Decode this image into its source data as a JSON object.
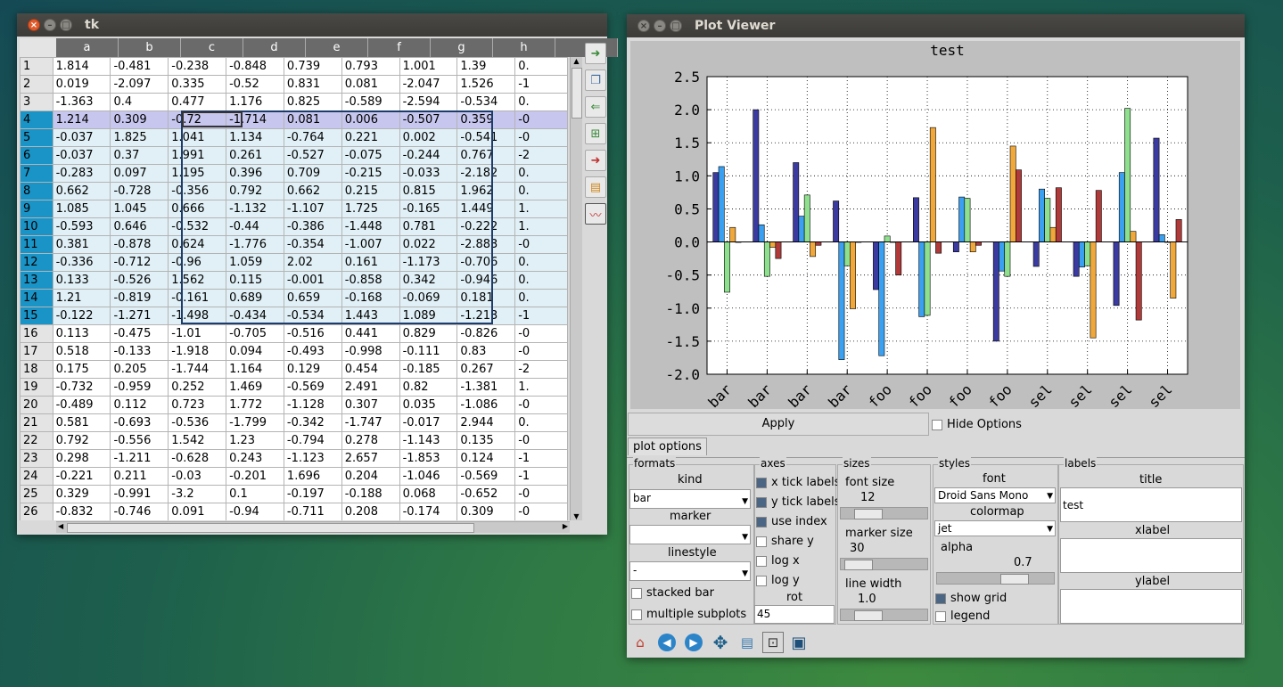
{
  "table_window": {
    "title": "tk",
    "columns": [
      "a",
      "b",
      "c",
      "d",
      "e",
      "f",
      "g",
      "h",
      ""
    ],
    "rows": [
      {
        "n": "1",
        "cells": [
          "1.814",
          "-0.481",
          "-0.238",
          "-0.848",
          "0.739",
          "0.793",
          "1.001",
          "1.39",
          "0."
        ]
      },
      {
        "n": "2",
        "cells": [
          "0.019",
          "-2.097",
          "0.335",
          "-0.52",
          "0.831",
          "0.081",
          "-2.047",
          "1.526",
          "-1"
        ]
      },
      {
        "n": "3",
        "cells": [
          "-1.363",
          "0.4",
          "0.477",
          "1.176",
          "0.825",
          "-0.589",
          "-2.594",
          "-0.534",
          "0."
        ]
      },
      {
        "n": "4",
        "cells": [
          "1.214",
          "0.309",
          "-0.72",
          "-1.714",
          "0.081",
          "0.006",
          "-0.507",
          "0.359",
          "-0"
        ]
      },
      {
        "n": "5",
        "cells": [
          "-0.037",
          "1.825",
          "1.041",
          "1.134",
          "-0.764",
          "0.221",
          "0.002",
          "-0.541",
          "-0"
        ]
      },
      {
        "n": "6",
        "cells": [
          "-0.037",
          "0.37",
          "1.991",
          "0.261",
          "-0.527",
          "-0.075",
          "-0.244",
          "0.767",
          "-2"
        ]
      },
      {
        "n": "7",
        "cells": [
          "-0.283",
          "0.097",
          "1.195",
          "0.396",
          "0.709",
          "-0.215",
          "-0.033",
          "-2.182",
          "0."
        ]
      },
      {
        "n": "8",
        "cells": [
          "0.662",
          "-0.728",
          "-0.356",
          "0.792",
          "0.662",
          "0.215",
          "0.815",
          "1.962",
          "0."
        ]
      },
      {
        "n": "9",
        "cells": [
          "1.085",
          "1.045",
          "0.666",
          "-1.132",
          "-1.107",
          "1.725",
          "-0.165",
          "1.449",
          "1."
        ]
      },
      {
        "n": "10",
        "cells": [
          "-0.593",
          "0.646",
          "-0.532",
          "-0.44",
          "-0.386",
          "-1.448",
          "0.781",
          "-0.222",
          "1."
        ]
      },
      {
        "n": "11",
        "cells": [
          "0.381",
          "-0.878",
          "0.624",
          "-1.776",
          "-0.354",
          "-1.007",
          "0.022",
          "-2.883",
          "-0"
        ]
      },
      {
        "n": "12",
        "cells": [
          "-0.336",
          "-0.712",
          "-0.96",
          "1.059",
          "2.02",
          "0.161",
          "-1.173",
          "-0.706",
          "0."
        ]
      },
      {
        "n": "13",
        "cells": [
          "0.133",
          "-0.526",
          "1.562",
          "0.115",
          "-0.001",
          "-0.858",
          "0.342",
          "-0.946",
          "0."
        ]
      },
      {
        "n": "14",
        "cells": [
          "1.21",
          "-0.819",
          "-0.161",
          "0.689",
          "0.659",
          "-0.168",
          "-0.069",
          "0.181",
          "0."
        ]
      },
      {
        "n": "15",
        "cells": [
          "-0.122",
          "-1.271",
          "-1.498",
          "-0.434",
          "-0.534",
          "1.443",
          "1.089",
          "-1.213",
          "-1"
        ]
      },
      {
        "n": "16",
        "cells": [
          "0.113",
          "-0.475",
          "-1.01",
          "-0.705",
          "-0.516",
          "0.441",
          "0.829",
          "-0.826",
          "-0"
        ]
      },
      {
        "n": "17",
        "cells": [
          "0.518",
          "-0.133",
          "-1.918",
          "0.094",
          "-0.493",
          "-0.998",
          "-0.111",
          "0.83",
          "-0"
        ]
      },
      {
        "n": "18",
        "cells": [
          "0.175",
          "0.205",
          "-1.744",
          "1.164",
          "0.129",
          "0.454",
          "-0.185",
          "0.267",
          "-2"
        ]
      },
      {
        "n": "19",
        "cells": [
          "-0.732",
          "-0.959",
          "0.252",
          "1.469",
          "-0.569",
          "2.491",
          "0.82",
          "-1.381",
          "1."
        ]
      },
      {
        "n": "20",
        "cells": [
          "-0.489",
          "0.112",
          "0.723",
          "1.772",
          "-1.128",
          "0.307",
          "0.035",
          "-1.086",
          "-0"
        ]
      },
      {
        "n": "21",
        "cells": [
          "0.581",
          "-0.693",
          "-0.536",
          "-1.799",
          "-0.342",
          "-1.747",
          "-0.017",
          "2.944",
          "0."
        ]
      },
      {
        "n": "22",
        "cells": [
          "0.792",
          "-0.556",
          "1.542",
          "1.23",
          "-0.794",
          "0.278",
          "-1.143",
          "0.135",
          "-0"
        ]
      },
      {
        "n": "23",
        "cells": [
          "0.298",
          "-1.211",
          "-0.628",
          "0.243",
          "-1.123",
          "2.657",
          "-1.853",
          "0.124",
          "-1"
        ]
      },
      {
        "n": "24",
        "cells": [
          "-0.221",
          "0.211",
          "-0.03",
          "-0.201",
          "1.696",
          "0.204",
          "-1.046",
          "-0.569",
          "-1"
        ]
      },
      {
        "n": "25",
        "cells": [
          "0.329",
          "-0.991",
          "-3.2",
          "0.1",
          "-0.197",
          "-0.188",
          "0.068",
          "-0.652",
          "-0"
        ]
      },
      {
        "n": "26",
        "cells": [
          "-0.832",
          "-0.746",
          "0.091",
          "-0.94",
          "-0.711",
          "0.208",
          "-0.174",
          "0.309",
          "-0"
        ]
      }
    ],
    "highlight_row": "4",
    "selected_rows": [
      "4",
      "5",
      "6",
      "7",
      "8",
      "9",
      "10",
      "11",
      "12",
      "13",
      "14",
      "15"
    ],
    "toolbar_icons": [
      "import-icon",
      "copy-icon",
      "paste-icon",
      "add-column-icon",
      "delete-icon",
      "clear-icon",
      "plot-icon"
    ]
  },
  "plot_window": {
    "title": "Plot Viewer",
    "apply_label": "Apply",
    "hide_options_label": "Hide Options",
    "tab_label": "plot options",
    "formats": {
      "group": "formats",
      "kind_label": "kind",
      "kind_value": "bar",
      "marker_label": "marker",
      "marker_value": "",
      "linestyle_label": "linestyle",
      "linestyle_value": "-",
      "stacked_label": "stacked bar",
      "multiple_label": "multiple subplots"
    },
    "axes": {
      "group": "axes",
      "x_tick": "x tick labels",
      "y_tick": "y tick labels",
      "use_index": "use index",
      "share_y": "share y",
      "log_x": "log x",
      "log_y": "log y",
      "rot_label": "rot",
      "rot_value": "45"
    },
    "sizes": {
      "group": "sizes",
      "font_size_label": "font size",
      "font_size_value": "12",
      "marker_size_label": "marker size",
      "marker_size_value": "30",
      "line_width_label": "line width",
      "line_width_value": "1.0"
    },
    "styles": {
      "group": "styles",
      "font_label": "font",
      "font_value": "Droid Sans Mono",
      "colormap_label": "colormap",
      "colormap_value": "jet",
      "alpha_label": "alpha",
      "alpha_value": "0.7",
      "show_grid": "show grid",
      "legend": "legend"
    },
    "labels": {
      "group": "labels",
      "title_label": "title",
      "title_value": "test",
      "xlabel_label": "xlabel",
      "xlabel_value": "",
      "ylabel_label": "ylabel",
      "ylabel_value": ""
    },
    "nav_icons": [
      "home-icon",
      "back-icon",
      "forward-icon",
      "pan-icon",
      "configure-icon",
      "zoom-icon",
      "save-icon"
    ]
  },
  "chart_data": {
    "type": "bar",
    "title": "test",
    "categories": [
      "bar",
      "bar",
      "bar",
      "bar",
      "foo",
      "foo",
      "foo",
      "foo",
      "sel",
      "sel",
      "sel",
      "sel"
    ],
    "ylim": [
      -2.0,
      2.5
    ],
    "yticks": [
      "2.5",
      "2.0",
      "1.5",
      "1.0",
      "0.5",
      "0.0",
      "-0.5",
      "-1.0",
      "-1.5",
      "-2.0"
    ],
    "grid": true,
    "colors": [
      "#3a3aa0",
      "#3ba0f0",
      "#8ee08e",
      "#f0a83a",
      "#b03a3a"
    ],
    "series": [
      {
        "values": [
          1.05,
          2.0,
          1.2,
          0.62,
          -0.72,
          0.67,
          -0.15,
          -1.5,
          -0.37,
          -0.52,
          -0.96,
          1.57
        ]
      },
      {
        "values": [
          1.14,
          0.26,
          0.39,
          -1.78,
          -1.72,
          -1.13,
          0.68,
          -0.44,
          0.8,
          -0.38,
          1.05,
          0.11
        ]
      },
      {
        "values": [
          -0.76,
          -0.52,
          0.71,
          -0.36,
          0.09,
          -1.11,
          0.66,
          -0.52,
          0.66,
          -0.36,
          2.02,
          0.0
        ]
      },
      {
        "values": [
          0.22,
          -0.08,
          -0.22,
          -1.01,
          0.0,
          1.73,
          -0.15,
          1.45,
          0.22,
          -1.45,
          0.16,
          -0.85
        ]
      },
      {
        "values": [
          0.0,
          -0.25,
          -0.05,
          0.0,
          -0.5,
          -0.17,
          -0.05,
          1.09,
          0.82,
          0.78,
          -1.18,
          0.34
        ]
      }
    ]
  }
}
